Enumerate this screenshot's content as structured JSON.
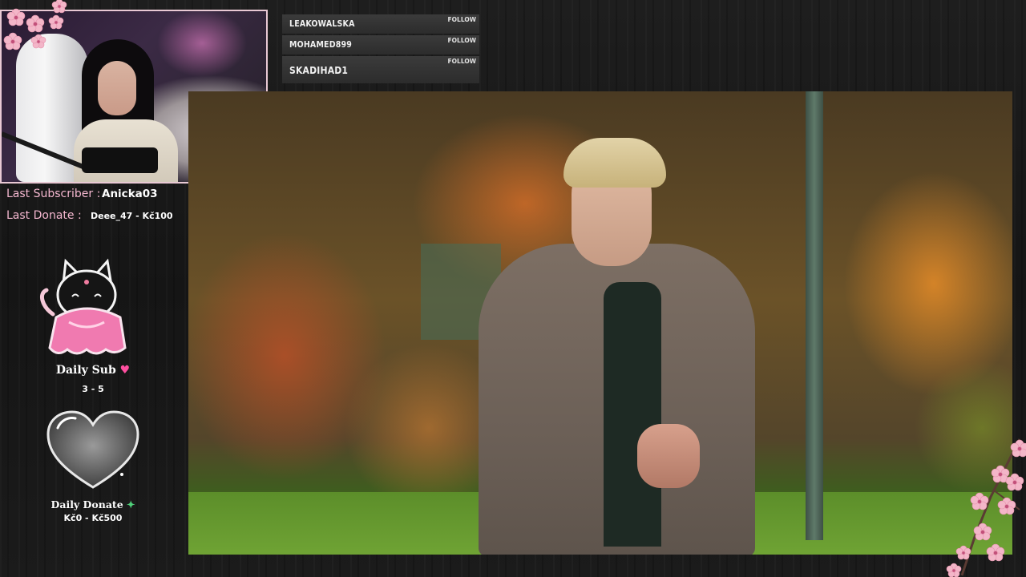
{
  "followers": [
    {
      "name": "LEAKOWALSKA",
      "tag": "FOLLOW"
    },
    {
      "name": "MOHAMED899",
      "tag": "FOLLOW"
    },
    {
      "name": "SKADIHAD1",
      "tag": "FOLLOW"
    }
  ],
  "last_subscriber": {
    "label": "Last Subscriber :",
    "value": "Anicka03"
  },
  "last_donate": {
    "label": "Last Donate :",
    "value": "Deee_47 - Kč100"
  },
  "daily_sub": {
    "label": "Daily Sub",
    "value": "3 - 5"
  },
  "daily_donate": {
    "label": "Daily Donate",
    "value": "Kč0 - Kč500"
  },
  "colors": {
    "accent_pink": "#f5b8d0",
    "blossom": "#f3b6c8",
    "panel_dark": "#2c2c2c"
  },
  "icons": {
    "heart": "heart-icon",
    "money": "money-icon",
    "cat": "cat-mascot"
  }
}
